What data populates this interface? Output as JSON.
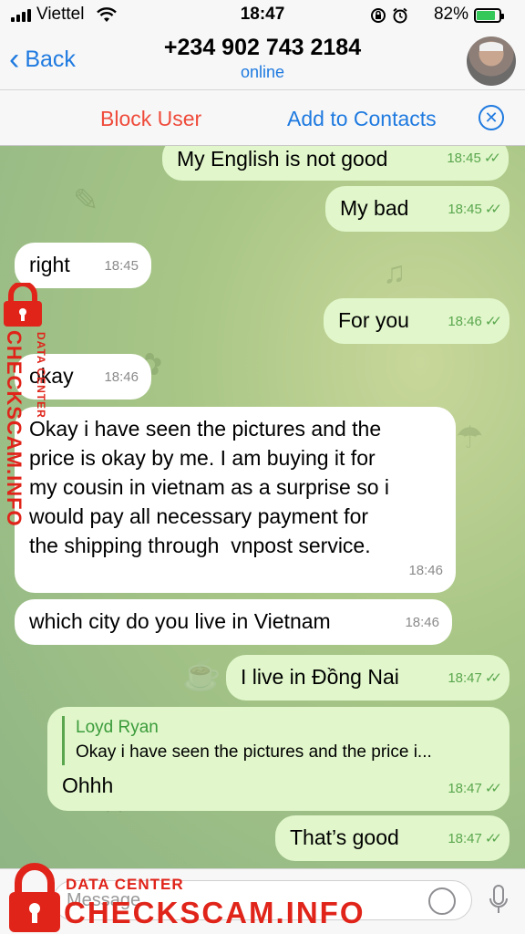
{
  "status_bar": {
    "carrier": "Viettel",
    "time": "18:47",
    "battery_percent": "82%",
    "icons": [
      "signal-icon",
      "wifi-icon",
      "orientation-lock-icon",
      "alarm-icon",
      "battery-icon"
    ]
  },
  "nav": {
    "back_label": "Back",
    "contact_name": "+234 902 743 2184",
    "contact_status": "online"
  },
  "action_bar": {
    "block_label": "Block User",
    "add_label": "Add to Contacts"
  },
  "messages": [
    {
      "dir": "out",
      "text": "My English is not good",
      "time": "18:45",
      "read": true
    },
    {
      "dir": "out",
      "text": "My bad",
      "time": "18:45",
      "read": true
    },
    {
      "dir": "in",
      "text": "right",
      "time": "18:45"
    },
    {
      "dir": "out",
      "text": "For you",
      "time": "18:46",
      "read": true
    },
    {
      "dir": "in",
      "text": "okay",
      "time": "18:46"
    },
    {
      "dir": "in",
      "lines": [
        "Okay i have seen the pictures and the",
        "price is okay by me. I am buying it for",
        "my cousin in vietnam as a surprise so i",
        "would pay all necessary payment for",
        "the shipping through  vnpost service."
      ],
      "time": "18:46"
    },
    {
      "dir": "in",
      "text": "which city do you live in Vietnam",
      "time": "18:46"
    },
    {
      "dir": "out",
      "text": "I live in Đồng Nai",
      "time": "18:47",
      "read": true
    },
    {
      "dir": "out",
      "reply": {
        "author": "Loyd Ryan",
        "text": "Okay i have seen the pictures and the price i..."
      },
      "text": "Ohhh",
      "time": "18:47",
      "read": true
    },
    {
      "dir": "out",
      "text": "That’s good",
      "time": "18:47",
      "read": true
    }
  ],
  "input": {
    "placeholder": "Message"
  },
  "watermark": {
    "small": "DATA CENTER",
    "big": "CHECKSCAM.INFO"
  },
  "colors": {
    "accent": "#1f7ae0",
    "danger": "#ef4b3b",
    "outgoing_bubble": "#e1f7cb",
    "incoming_bubble": "#ffffff",
    "read_ticks": "#5aa64e",
    "watermark": "#e0241a"
  }
}
